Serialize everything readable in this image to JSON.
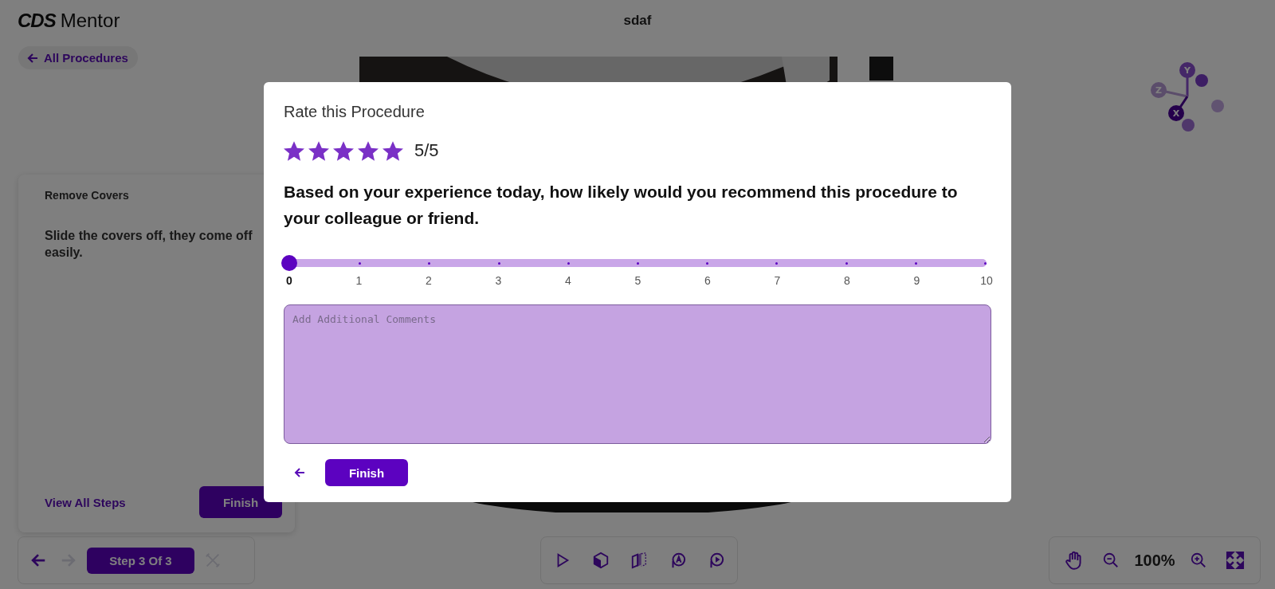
{
  "header": {
    "logo_mark": "CDS",
    "logo_text": "Mentor",
    "title": "sdaf"
  },
  "back_link": {
    "label": "All Procedures"
  },
  "gizmo": {
    "axes": [
      "Y",
      "Z",
      "X"
    ]
  },
  "step_card": {
    "title": "Remove Covers",
    "description": "Slide the covers off, they come off easily.",
    "link": "View All Steps",
    "button": "Finish"
  },
  "step_nav": {
    "prev_disabled": false,
    "next_disabled": true,
    "label": "Step 3 Of 3",
    "tools_disabled": true
  },
  "zoom": {
    "value": "100%"
  },
  "dialog": {
    "title": "Rate this Procedure",
    "rating": {
      "stars": 5,
      "reading": "5/5"
    },
    "question": "Based on your experience today, how likely would you recommend this procedure to your colleague or friend.",
    "nps": {
      "level": 0,
      "ticks": [
        "0",
        "1",
        "2",
        "3",
        "4",
        "5",
        "6",
        "7",
        "8",
        "9",
        "10"
      ]
    },
    "comments": {
      "placeholder": "Add Additional Comments"
    },
    "finish": "Finish"
  }
}
